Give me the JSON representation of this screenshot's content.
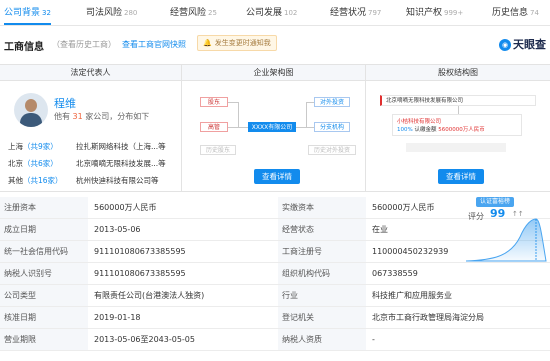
{
  "tabs": [
    {
      "label": "公司背景",
      "count": "32",
      "active": true
    },
    {
      "label": "司法风险",
      "count": "280"
    },
    {
      "label": "经营风险",
      "count": "25"
    },
    {
      "label": "公司发展",
      "count": "102"
    },
    {
      "label": "经营状况",
      "count": "797"
    },
    {
      "label": "知识产权",
      "count": "999+"
    },
    {
      "label": "历史信息",
      "count": "74"
    }
  ],
  "header": {
    "title": "工商信息",
    "history_link": "（查看历史工商）",
    "official_link": "查看工商官网快照",
    "notify": "发生变更时通知我",
    "brand": "天眼查"
  },
  "panels": {
    "legal_rep": {
      "title": "法定代表人",
      "name": "程维",
      "sub_prefix": "他有",
      "sub_count": "31",
      "sub_suffix": "家公司，分布如下",
      "rows": [
        {
          "city": "上海",
          "count": "（共9家）",
          "company": "拉扎斯网络科技（上海...等"
        },
        {
          "city": "北京",
          "count": "（共6家）",
          "company": "北京嘀嘀无限科技发展...等"
        },
        {
          "city": "其他",
          "count": "（共16家）",
          "company": "杭州快迪科技有限公司等"
        }
      ]
    },
    "structure": {
      "title": "企业架构图",
      "nodes": {
        "shareholder": "股东",
        "invest": "对外投资",
        "exec": "高管",
        "main": "XXXX有限公司",
        "branch": "分支机构",
        "history1": "历史股东",
        "history2": "历史对外投资"
      },
      "button": "查看详情"
    },
    "equity": {
      "title": "股权结构图",
      "top": "北京嘀嘀无限科技发展有限公司",
      "mid_name": "小桔科技有限公司",
      "mid_ratio_label": "认缴金额",
      "mid_ratio": "5600000万人民币",
      "mid_pct": "100%",
      "button": "查看详情"
    }
  },
  "info_rows": [
    {
      "l1": "注册资本",
      "v1": "560000万人民币",
      "l2": "实缴资本",
      "v2": "560000万人民币"
    },
    {
      "l1": "成立日期",
      "v1": "2013-05-06",
      "l2": "经营状态",
      "v2": "在业"
    },
    {
      "l1": "统一社会信用代码",
      "v1": "911101080673385595",
      "l2": "工商注册号",
      "v2": "110000450232939"
    },
    {
      "l1": "纳税人识别号",
      "v1": "911101080673385595",
      "l2": "组织机构代码",
      "v2": "067338559"
    },
    {
      "l1": "公司类型",
      "v1": "有限责任公司(台港澳法人独资)",
      "l2": "行业",
      "v2": "科技推广和应用服务业"
    },
    {
      "l1": "核准日期",
      "v1": "2019-01-18",
      "l2": "登记机关",
      "v2": "北京市工商行政管理局海淀分局"
    },
    {
      "l1": "营业期限",
      "v1": "2013-05-06至2043-05-05",
      "l2": "纳税人资质",
      "v2": "-"
    }
  ],
  "score": {
    "badge": "认证富裕榜",
    "label": "评分",
    "value": "99",
    "sep": "↑↑"
  },
  "colors": {
    "accent": "#128bed",
    "highlight": "#f0643c"
  }
}
